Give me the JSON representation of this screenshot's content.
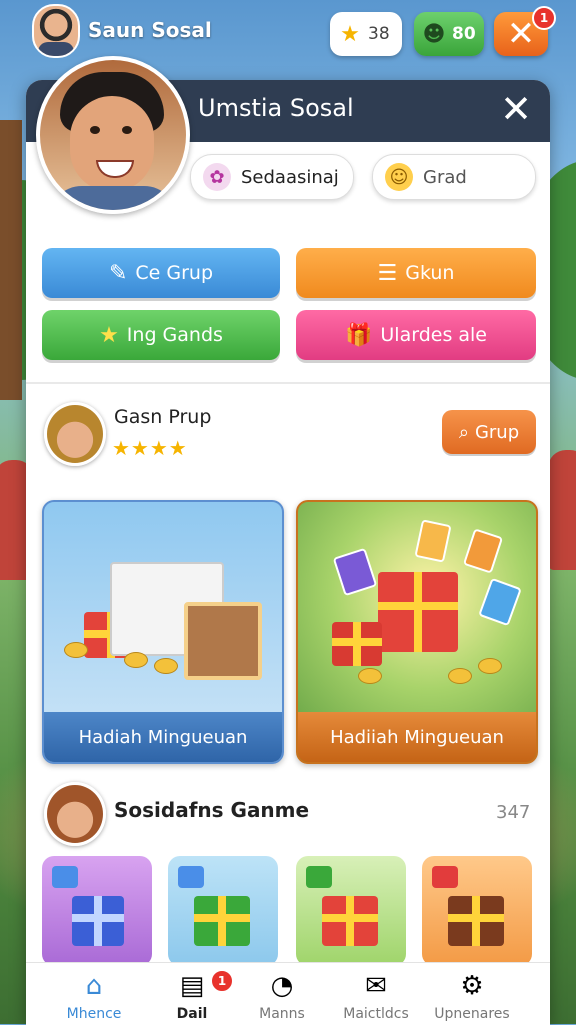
{
  "topbar": {
    "user_name": "Saun Sosal",
    "stars_count": "38",
    "gems_count": "80",
    "close_badge": "1"
  },
  "panel": {
    "title": "Umstia Sosal",
    "chips": [
      {
        "label": "Sedaasinaj",
        "icon": "flower-icon"
      },
      {
        "label": "Grad",
        "icon": "smile-icon"
      }
    ],
    "buttons": [
      {
        "label": "Ce Grup",
        "icon": "pencil-icon",
        "color": "#3a8ad6"
      },
      {
        "label": "Gkun",
        "icon": "list-icon",
        "color": "#f08a1e"
      },
      {
        "label": "Ing Gands",
        "icon": "star-icon",
        "color": "#3aa83a"
      },
      {
        "label": "Ulardes ale",
        "icon": "gift-icon",
        "color": "#e23c82"
      }
    ],
    "group": {
      "title": "Gasn Prup",
      "stars": "★★★★",
      "button_label": "Grup"
    },
    "cards": [
      {
        "label": "Hadiah Mingueuan"
      },
      {
        "label": "Hadiiah Mingueuan"
      }
    ],
    "section2": {
      "title": "Sosidafns Ganme",
      "count": "347"
    }
  },
  "nav": {
    "items": [
      {
        "label": "Mhence",
        "icon": "home-icon"
      },
      {
        "label": "Dail",
        "icon": "inbox-icon",
        "badge": "1"
      },
      {
        "label": "Manns",
        "icon": "chat-icon"
      },
      {
        "label": "Maictldcs",
        "icon": "messages-icon"
      },
      {
        "label": "Upnenares",
        "icon": "gear-icon"
      }
    ]
  }
}
